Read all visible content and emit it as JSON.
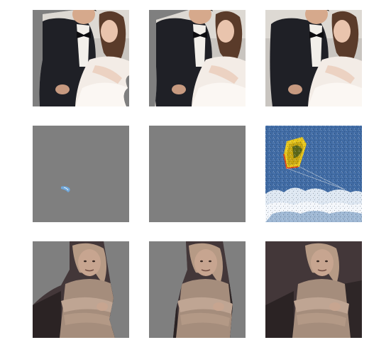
{
  "figure": {
    "rows": 3,
    "cols": 3,
    "background": "#ffffff",
    "mask_gray": "#7f7f7f",
    "tiles": [
      {
        "row": 0,
        "col": 0,
        "subject": "wedding-couple",
        "variant": "masked-coarse"
      },
      {
        "row": 0,
        "col": 1,
        "subject": "wedding-couple",
        "variant": "masked-fine"
      },
      {
        "row": 0,
        "col": 2,
        "subject": "wedding-couple",
        "variant": "original"
      },
      {
        "row": 1,
        "col": 0,
        "subject": "kite-over-clouds",
        "variant": "masked-coarse"
      },
      {
        "row": 1,
        "col": 1,
        "subject": "kite-over-clouds",
        "variant": "masked-fine"
      },
      {
        "row": 1,
        "col": 2,
        "subject": "kite-over-clouds",
        "variant": "original"
      },
      {
        "row": 2,
        "col": 0,
        "subject": "woman-portrait",
        "variant": "masked-coarse"
      },
      {
        "row": 2,
        "col": 1,
        "subject": "woman-portrait",
        "variant": "masked-fine"
      },
      {
        "row": 2,
        "col": 2,
        "subject": "woman-portrait",
        "variant": "original"
      }
    ]
  }
}
